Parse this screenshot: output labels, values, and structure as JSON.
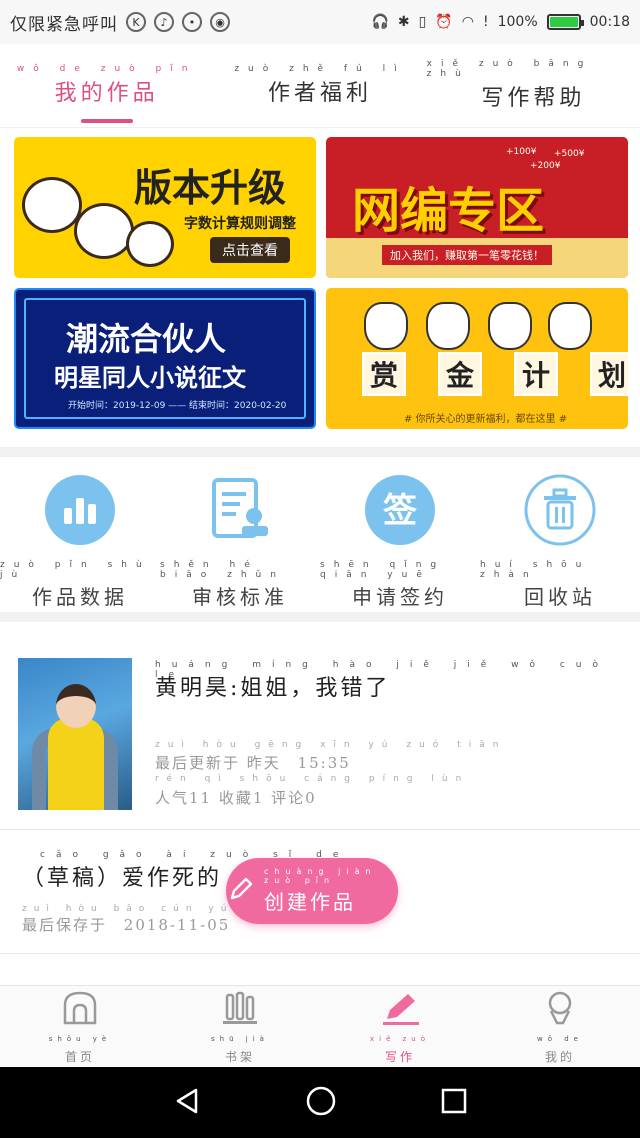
{
  "status_bar": {
    "carrier": "仅限紧急呼叫",
    "battery_text": "100%",
    "time": "00:18",
    "battery_level": 1.0
  },
  "top_tabs": [
    {
      "pinyin": "wǒ de zuò pǐn",
      "label": "我的作品",
      "active": true
    },
    {
      "pinyin": "zuò zhě fú lì",
      "label": "作者福利",
      "active": false
    },
    {
      "pinyin": "xiě zuò bāng zhù",
      "label": "写作帮助",
      "active": false
    }
  ],
  "banners": {
    "upgrade": {
      "title": "版本升级",
      "subtitle": "字数计算规则调整",
      "button": "点击查看"
    },
    "net_zone": {
      "title": "网编专区",
      "cta": "加入我们，赚取第一笔零花钱！",
      "reward_a": "+100¥",
      "reward_b": "+500¥",
      "reward_c": "+200¥"
    },
    "trend": {
      "title": "潮流合伙人",
      "subtitle": "明星同人小说征文",
      "dates": "开始时间：2019-12-09 —— 结束时间：2020-02-20"
    },
    "bounty": {
      "cards": [
        "赏",
        "金",
        "计",
        "划"
      ],
      "note": "# 你所关心的更新福利，都在这里 #"
    }
  },
  "tools": [
    {
      "pinyin": "zuò pǐn shù jù",
      "label": "作品数据",
      "icon": "bar-chart-icon"
    },
    {
      "pinyin": "shěn hé biāo zhǔn",
      "label": "审核标准",
      "icon": "review-doc-icon"
    },
    {
      "pinyin": "shēn qǐng qiān yuē",
      "label": "申请签约",
      "icon": "sign-icon",
      "icon_text": "签"
    },
    {
      "pinyin": "huí shōu zhàn",
      "label": "回收站",
      "icon": "trash-icon"
    }
  ],
  "works": [
    {
      "title_pinyin": "huáng míng hào jiě jiě wǒ cuò le",
      "title": "黄明昊:姐姐，我错了",
      "updated_pinyin": "zuì hòu gēng xīn yú zuó tiān",
      "updated_label": "最后更新于",
      "updated_day": "昨天",
      "updated_time": "15:35",
      "stats_pinyin": "rén qì shōu cáng píng lùn",
      "stats": "人气11 收藏1 评论0"
    }
  ],
  "draft": {
    "title_pinyin": "cǎo gǎo ài zuò sǐ de",
    "title": "（草稿）爱作死的",
    "saved_pinyin": "zuì hòu bǎo cún yú",
    "saved_label": "最后保存于",
    "saved_date": "2018-11-05"
  },
  "create_button": {
    "pinyin": "chuàng jiàn zuò pǐn",
    "label": "创建作品"
  },
  "bottom_nav": [
    {
      "pinyin": "shǒu yè",
      "label": "首页",
      "active": false
    },
    {
      "pinyin": "shū jià",
      "label": "书架",
      "active": false
    },
    {
      "pinyin": "xiě zuò",
      "label": "写作",
      "active": true
    },
    {
      "pinyin": "wǒ de",
      "label": "我的",
      "active": false
    }
  ],
  "colors": {
    "accent": "#e0507f",
    "tool_blue": "#7cc2ee"
  }
}
